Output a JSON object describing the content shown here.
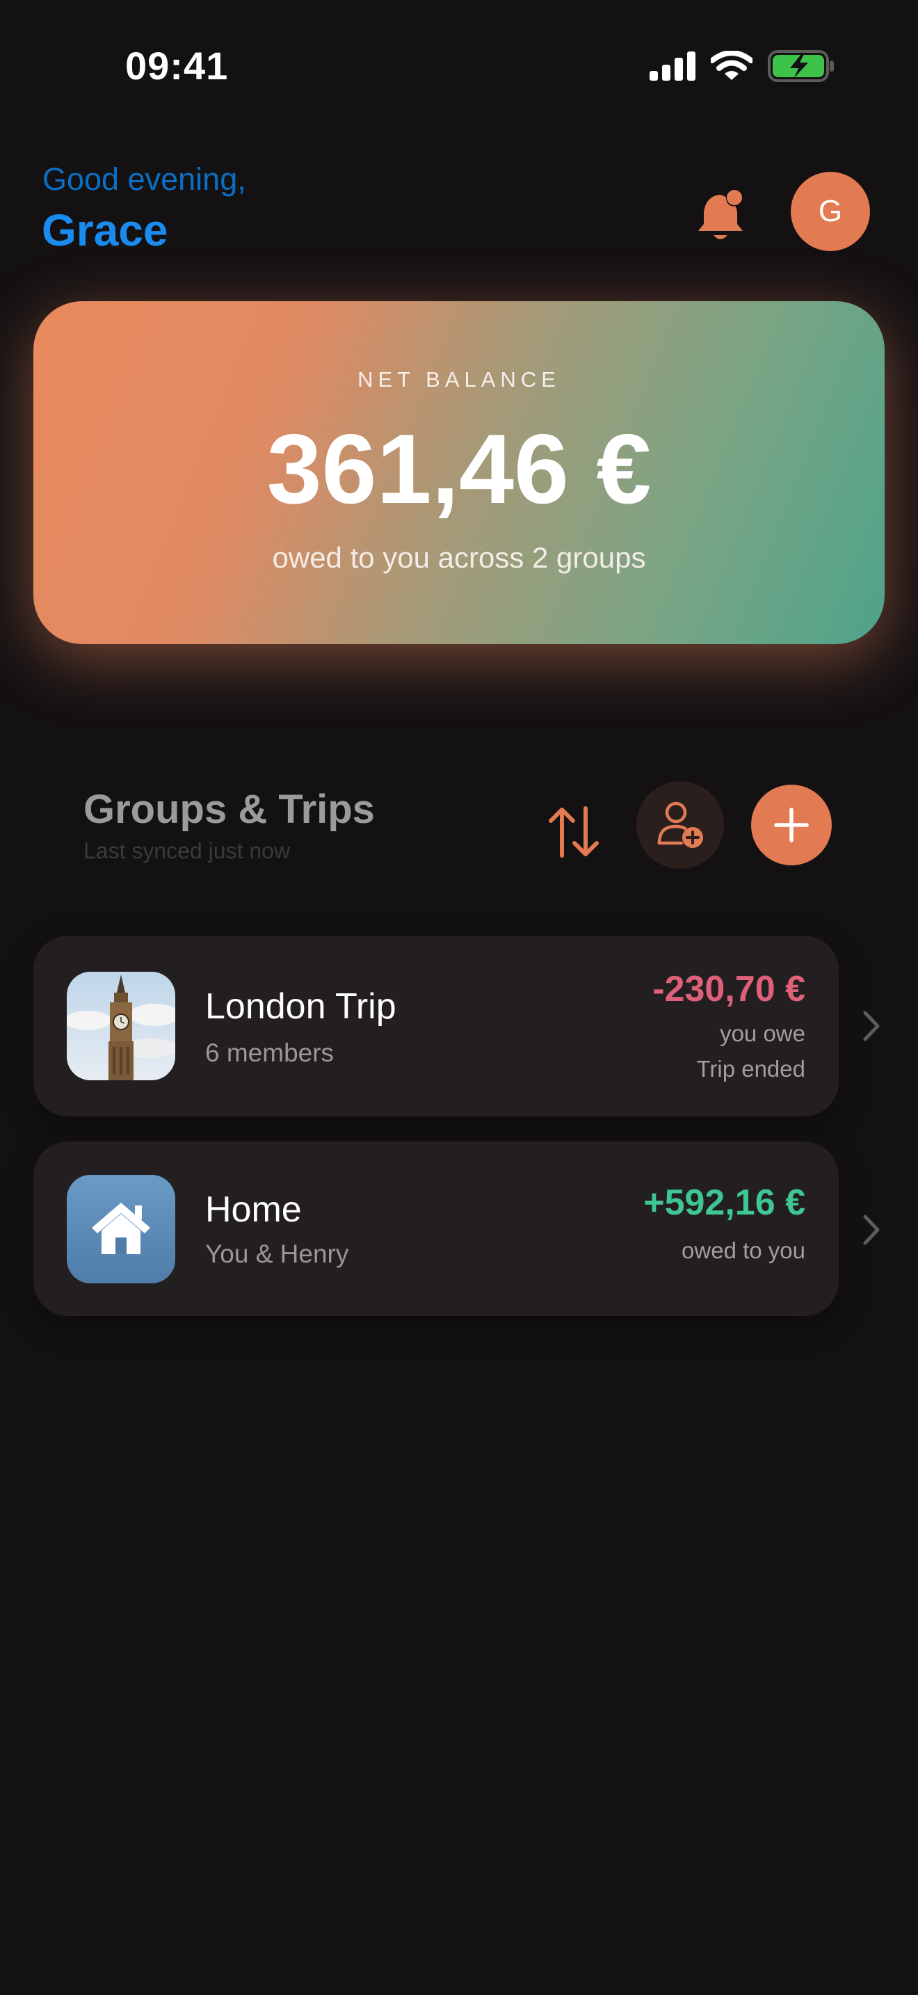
{
  "status_bar": {
    "time": "09:41"
  },
  "header": {
    "greeting": "Good evening,",
    "name": "Grace",
    "avatar_initial": "G"
  },
  "balance": {
    "label": "NET BALANCE",
    "amount": "361,46 €",
    "subtitle": "owed to you across 2 groups"
  },
  "section": {
    "title": "Groups & Trips",
    "subtitle": "Last synced just now"
  },
  "groups": [
    {
      "name": "London Trip",
      "members": "6 members",
      "amount": "-230,70 €",
      "note": "you owe",
      "status": "Trip ended",
      "icon": "big-ben-photo"
    },
    {
      "name": "Home",
      "members": "You & Henry",
      "amount": "+592,16 €",
      "note": "owed to you",
      "icon": "house-icon"
    }
  ],
  "colors": {
    "accent": "#E27A52",
    "greeting_blue": "#1A8CF0",
    "negative": "#E0607A",
    "positive": "#3EC693",
    "background": "#141113",
    "card": "#231F21"
  }
}
